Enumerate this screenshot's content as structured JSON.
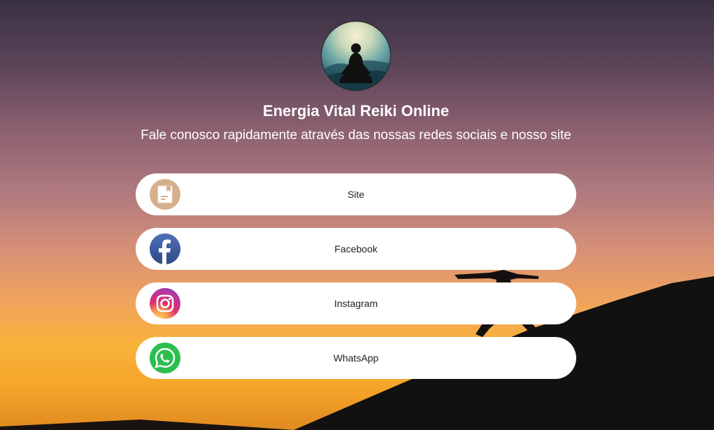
{
  "profile": {
    "avatar_icon": "meditation-avatar",
    "title": "Energia Vital Reiki Online",
    "subtitle": "Fale conosco rapidamente através das nossas redes sociais e nosso site"
  },
  "links": [
    {
      "label": "Site",
      "icon": "document-icon",
      "color": "#d6b08e"
    },
    {
      "label": "Facebook",
      "icon": "facebook-icon",
      "color": "#3b5998"
    },
    {
      "label": "Instagram",
      "icon": "instagram-icon",
      "color": "#e1306c"
    },
    {
      "label": "WhatsApp",
      "icon": "whatsapp-icon",
      "color": "#25d366"
    }
  ]
}
